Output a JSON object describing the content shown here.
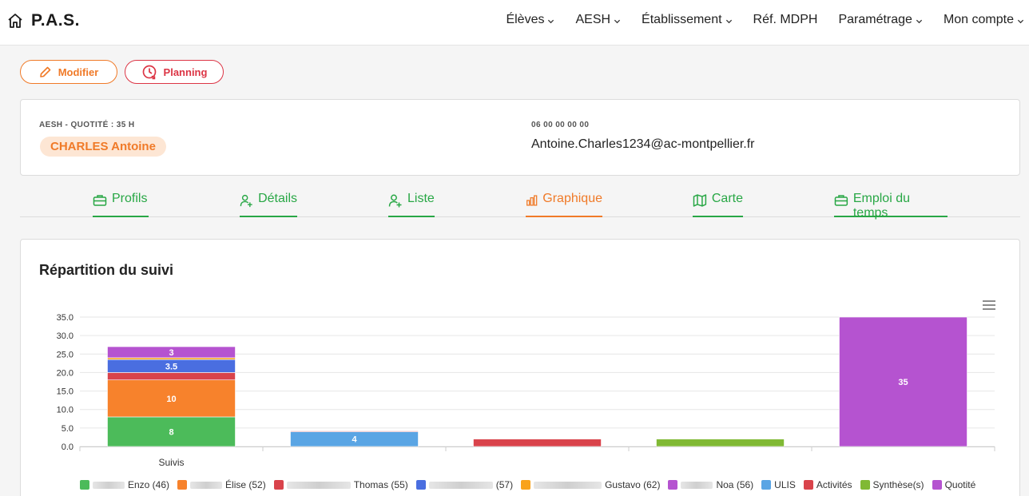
{
  "navbar": {
    "brand": "P.A.S.",
    "items": [
      {
        "label": "Élèves",
        "dropdown": true
      },
      {
        "label": "AESH",
        "dropdown": true
      },
      {
        "label": "Établissement",
        "dropdown": true
      },
      {
        "label": "Réf. MDPH",
        "dropdown": false
      },
      {
        "label": "Paramétrage",
        "dropdown": true
      },
      {
        "label": "Mon compte",
        "dropdown": true
      }
    ]
  },
  "actions": {
    "modifier": "Modifier",
    "planning": "Planning"
  },
  "profile": {
    "role_label": "AESH - QUOTITÉ : 35 H",
    "name": "CHARLES Antoine",
    "phone": "06 00 00 00 00",
    "email": "Antoine.Charles1234@ac-montpellier.fr"
  },
  "tabs": [
    {
      "label": "Profils",
      "icon": "briefcase-icon",
      "active": false
    },
    {
      "label": "Détails",
      "icon": "user-plus-icon",
      "active": false
    },
    {
      "label": "Liste",
      "icon": "user-plus-icon",
      "active": false
    },
    {
      "label": "Graphique",
      "icon": "bar-chart-icon",
      "active": true
    },
    {
      "label": "Carte",
      "icon": "map-icon",
      "active": false
    },
    {
      "label": "Emploi du temps",
      "icon": "briefcase-icon",
      "active": false
    }
  ],
  "colors": {
    "primary_orange": "#f07a28",
    "danger_red": "#dc3545",
    "success_green": "#28a745"
  },
  "chart_data": {
    "type": "bar",
    "stacked": true,
    "title": "Répartition du suivi",
    "categories": [
      "Suivis",
      "",
      "",
      "",
      ""
    ],
    "ylim": [
      0,
      35
    ],
    "yticks": [
      "0.0",
      "5.0",
      "10.0",
      "15.0",
      "20.0",
      "25.0",
      "30.0",
      "35.0"
    ],
    "grid": true,
    "legend_position": "bottom",
    "series": [
      {
        "name": "Enzo (46)",
        "color": "#4cbb5a",
        "values": [
          8,
          0,
          0,
          0,
          0
        ],
        "labels": [
          "8",
          "",
          "",
          "",
          ""
        ]
      },
      {
        "name": "Élise (52)",
        "color": "#f7822c",
        "values": [
          10,
          0,
          0,
          0,
          0
        ],
        "labels": [
          "10",
          "",
          "",
          "",
          ""
        ]
      },
      {
        "name": "Thomas (55)",
        "color": "#d9434b",
        "values": [
          2,
          0,
          0,
          0,
          0
        ],
        "labels": [
          "",
          "",
          "",
          "",
          ""
        ]
      },
      {
        "name": "(57)",
        "color": "#4a6ee0",
        "values": [
          3.5,
          0,
          0,
          0,
          0
        ],
        "labels": [
          "3.5",
          "",
          "",
          "",
          ""
        ]
      },
      {
        "name": "Gustavo (62)",
        "color": "#f9a31b",
        "values": [
          0.5,
          0,
          0,
          0,
          0
        ],
        "labels": [
          "",
          "",
          "",
          "",
          ""
        ]
      },
      {
        "name": "Noa (56)",
        "color": "#b553d0",
        "values": [
          3,
          0,
          0,
          0,
          0
        ],
        "labels": [
          "3",
          "",
          "",
          "",
          ""
        ]
      },
      {
        "name": "ULIS",
        "color": "#5aa5e4",
        "values": [
          0,
          4,
          0,
          0,
          0
        ],
        "labels": [
          "",
          "4",
          "",
          "",
          ""
        ]
      },
      {
        "name": "Activités",
        "color": "#d9434b",
        "values": [
          0,
          0.2,
          2,
          0,
          0
        ],
        "labels": [
          "",
          "",
          "",
          "",
          ""
        ]
      },
      {
        "name": "Synthèse(s)",
        "color": "#80b934",
        "values": [
          0,
          0,
          0,
          2,
          0
        ],
        "labels": [
          "",
          "",
          "",
          "",
          ""
        ]
      },
      {
        "name": "Quotité",
        "color": "#b553d0",
        "values": [
          0,
          0,
          0,
          0,
          35
        ],
        "labels": [
          "",
          "",
          "",
          "",
          "35"
        ]
      }
    ],
    "blurred_prefix": [
      true,
      true,
      true,
      true,
      true,
      true,
      false,
      false,
      false,
      false
    ]
  }
}
